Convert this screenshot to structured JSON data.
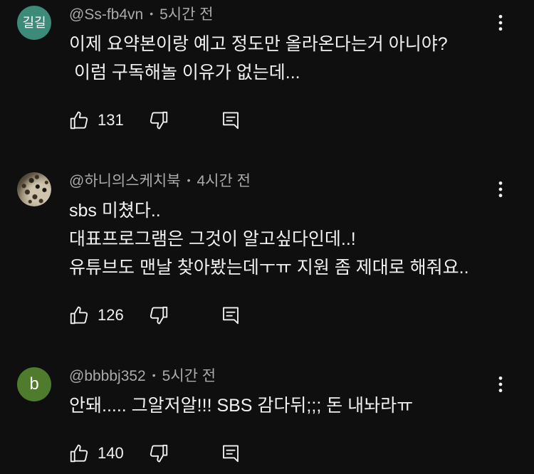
{
  "colors": {
    "background": "#0f0f0f",
    "text": "#f1f1f1",
    "meta": "#aaaaaa"
  },
  "icons": {
    "like": "thumbs-up-icon",
    "dislike": "thumbs-down-icon",
    "reply": "reply-icon",
    "menu": "more-vertical-icon"
  },
  "ui": {
    "separator": "•"
  },
  "comments": [
    {
      "avatar": {
        "initials": "길길",
        "color": "#3c8b79"
      },
      "author": "@Ss-fb4vn",
      "time": "5시간 전",
      "lines": [
        "이제 요약본이랑 예고 정도만 올라온다는거 아니야?",
        " 이럼 구독해놀 이유가 없는데..."
      ],
      "likes": 131
    },
    {
      "avatar": {
        "image": true
      },
      "author": "@하니의스케치북",
      "time": "4시간 전",
      "lines": [
        "sbs 미쳤다..",
        "대표프로그램은 그것이 알고싶다인데..!",
        "유튜브도 맨날 찾아봤는데ㅜㅠ 지원 좀 제대로 해줘요.."
      ],
      "likes": 126
    },
    {
      "avatar": {
        "initials": "b",
        "color": "#4e7c2c"
      },
      "author": "@bbbbj352",
      "time": "5시간 전",
      "lines": [
        "안돼..... 그알저알!!! SBS 감다뒤;;; 돈 내놔라ㅠ"
      ],
      "likes": 140
    }
  ]
}
